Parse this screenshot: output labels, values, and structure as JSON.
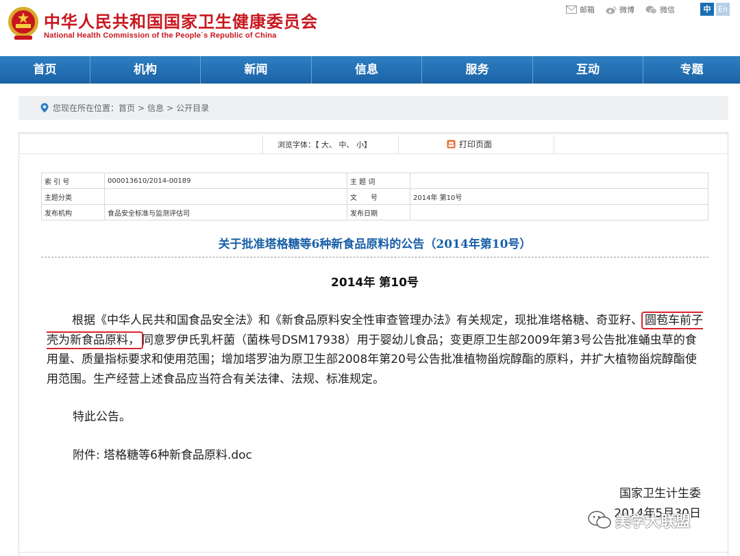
{
  "header": {
    "title": "中华人民共和国国家卫生健康委员会",
    "subtitle": "National Health Commission of the People´s Republic of China",
    "links": [
      {
        "label": "邮箱",
        "icon": "mail-icon"
      },
      {
        "label": "微博",
        "icon": "weibo-icon"
      },
      {
        "label": "微信",
        "icon": "wechat-icon"
      }
    ],
    "lang_zh": "中",
    "lang_en": "En",
    "brand_red": "#c8161d",
    "brand_blue": "#1b63a6"
  },
  "nav": {
    "items": [
      "首页",
      "机构",
      "新闻",
      "信息",
      "服务",
      "互动",
      "专题"
    ]
  },
  "breadcrumb": {
    "prefix": "您现在所在位置：",
    "items": [
      "首页",
      "信息",
      "公开目录"
    ],
    "sep": ">"
  },
  "toolbar": {
    "font_label": "浏览字体：【",
    "font_large": "大",
    "font_medium": "中",
    "font_small": "小",
    "font_close": "】",
    "print_label": "打印页面"
  },
  "meta": {
    "index_key": "索 引 号",
    "index_val": "000013610/2014-00189",
    "keyword_key": "主 题 词",
    "keyword_val": "",
    "category_key": "主题分类",
    "category_val": "",
    "doc_key": "文　　号",
    "doc_val": "2014年 第10号",
    "issuer_key": "发布机构",
    "issuer_val": "食品安全标准与监测评估司",
    "date_key": "发布日期",
    "date_val": ""
  },
  "document": {
    "title": "关于批准塔格糖等6种新食品原料的公告（2014年第10号）",
    "number": "2014年 第10号",
    "para_part1": "根据《中华人民共和国食品安全法》和《新食品原料安全性审查管理办法》有关规定，现批准塔格糖、奇亚籽、",
    "para_highlight": "圆苞车前子壳为新食品原料，",
    "para_part2": "同意罗伊氏乳杆菌（菌株号DSM17938）用于婴幼儿食品；变更原卫生部2009年第3号公告批准蛹虫草的食用量、质量指标要求和使用范围；增加塔罗油为原卫生部2008年第20号公告批准植物甾烷醇酯的原料，并扩大植物甾烷醇酯使用范围。生产经营上述食品应当符合有关法律、法规、标准规定。",
    "closing": "特此公告。",
    "attachment_label": "附件: ",
    "attachment_file": "塔格糖等6种新食品原料.doc",
    "signer": "国家卫生计生委",
    "date": "2014年5月30日"
  },
  "watermark": {
    "text": "美学大联盟"
  }
}
